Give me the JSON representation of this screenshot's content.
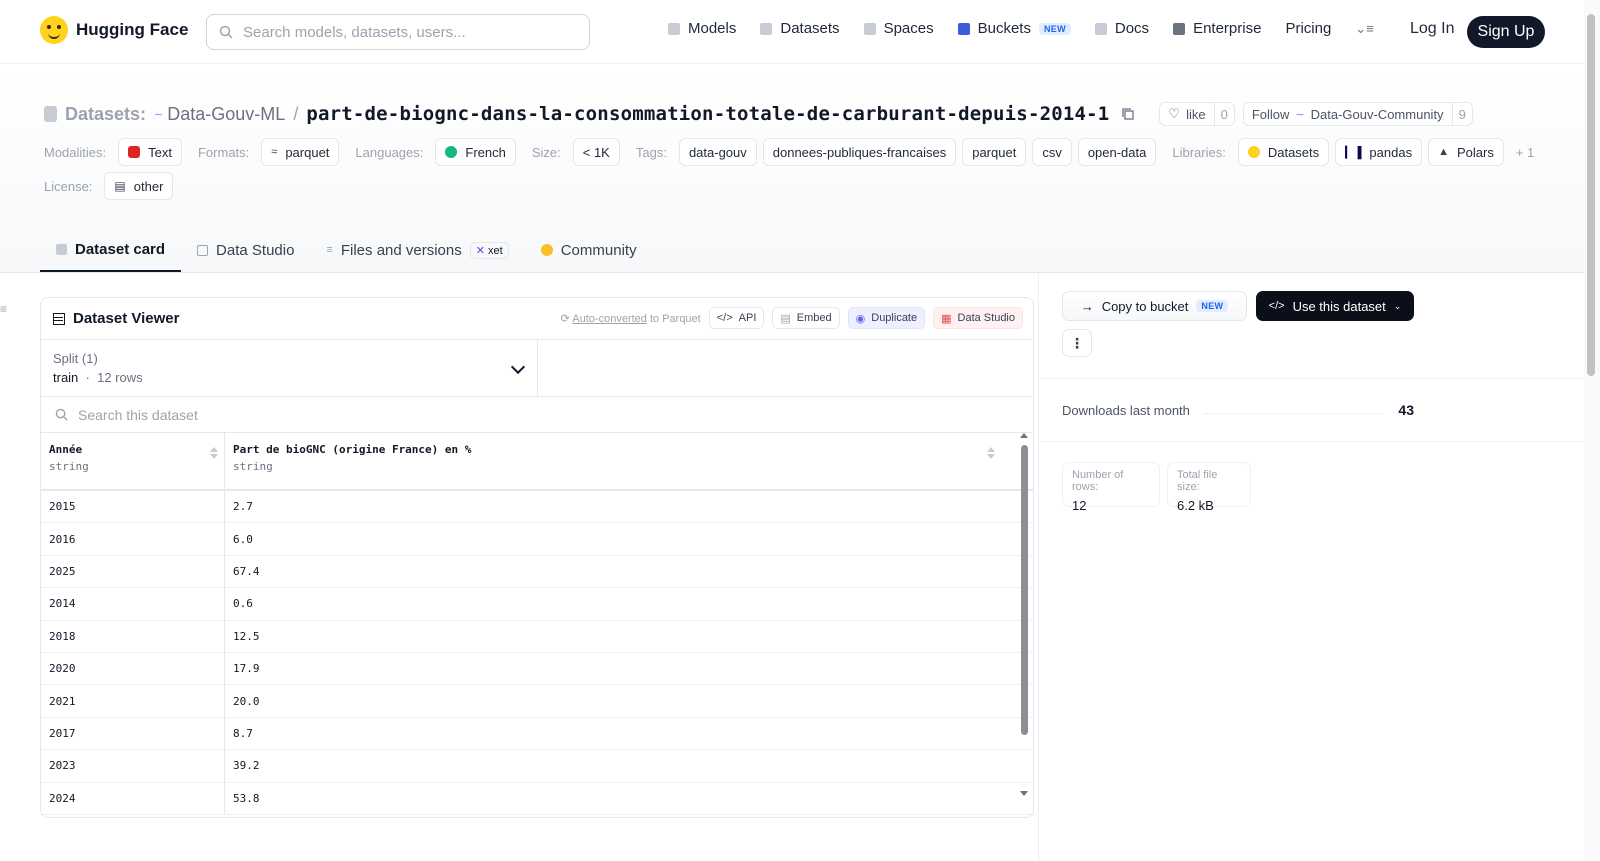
{
  "header": {
    "brand": "Hugging Face",
    "search_placeholder": "Search models, datasets, users...",
    "nav": [
      "Models",
      "Datasets",
      "Spaces",
      "Buckets",
      "Docs",
      "Enterprise",
      "Pricing"
    ],
    "buckets_badge": "NEW",
    "login": "Log In",
    "signup": "Sign Up"
  },
  "title": {
    "section": "Datasets:",
    "org": "Data-Gouv-ML",
    "name": "part-de-biognc-dans-la-consommation-totale-de-carburant-depuis-2014-1",
    "like_label": "like",
    "like_count": "0",
    "follow_label": "Follow",
    "follow_org": "Data-Gouv-Community",
    "follow_count": "9"
  },
  "meta": {
    "modalities_label": "Modalities:",
    "modality": "Text",
    "formats_label": "Formats:",
    "format": "parquet",
    "languages_label": "Languages:",
    "language": "French",
    "size_label": "Size:",
    "size": "< 1K",
    "tags_label": "Tags:",
    "tags": [
      "data-gouv",
      "donnees-publiques-francaises",
      "parquet",
      "csv",
      "open-data"
    ],
    "libraries_label": "Libraries:",
    "libraries": [
      "Datasets",
      "pandas",
      "Polars"
    ],
    "libraries_more": "+ 1",
    "license_label": "License:",
    "license": "other"
  },
  "tabs": {
    "dataset_card": "Dataset card",
    "data_studio": "Data Studio",
    "files": "Files and versions",
    "xet": "xet",
    "community": "Community"
  },
  "viewer": {
    "title": "Dataset Viewer",
    "auto_converted": "Auto-converted",
    "to_parquet": "to Parquet",
    "api": "API",
    "embed": "Embed",
    "duplicate": "Duplicate",
    "data_studio": "Data Studio",
    "split_label": "Split (1)",
    "split_name": "train",
    "split_rows": "12 rows",
    "search_placeholder": "Search this dataset",
    "columns": [
      {
        "name": "Année",
        "type": "string"
      },
      {
        "name": "Part de bioGNC (origine France) en %",
        "type": "string"
      }
    ],
    "rows": [
      [
        "2015",
        "2.7"
      ],
      [
        "2016",
        "6.0"
      ],
      [
        "2025",
        "67.4"
      ],
      [
        "2014",
        "0.6"
      ],
      [
        "2018",
        "12.5"
      ],
      [
        "2020",
        "17.9"
      ],
      [
        "2021",
        "20.0"
      ],
      [
        "2017",
        "8.7"
      ],
      [
        "2023",
        "39.2"
      ],
      [
        "2024",
        "53.8"
      ]
    ]
  },
  "sidebar": {
    "copy_to_bucket": "Copy to bucket",
    "copy_badge": "NEW",
    "use_dataset": "Use this dataset",
    "downloads_label": "Downloads last month",
    "downloads": "43",
    "rows_label": "Number of rows:",
    "rows_value": "12",
    "filesize_label": "Total file size:",
    "filesize_value": "6.2 kB"
  }
}
